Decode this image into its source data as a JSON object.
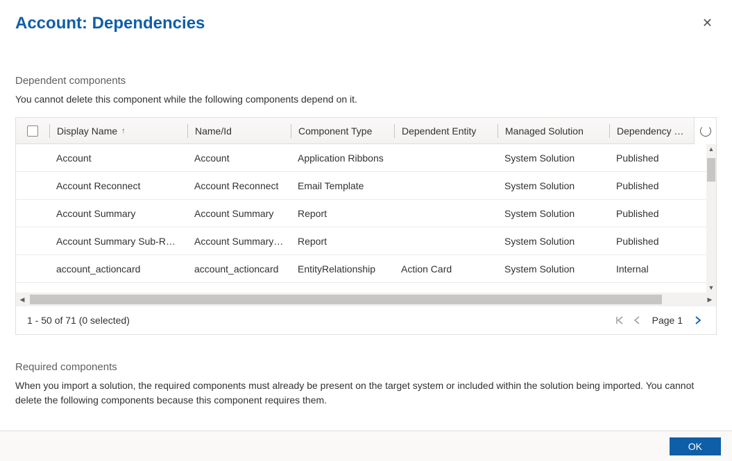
{
  "dialog": {
    "title": "Account: Dependencies",
    "close_label": "✕",
    "ok_label": "OK"
  },
  "dependent": {
    "section_title": "Dependent components",
    "description": "You cannot delete this component while the following components depend on it.",
    "columns": {
      "display": "Display Name",
      "name": "Name/Id",
      "type": "Component Type",
      "entity": "Dependent Entity",
      "managed": "Managed Solution",
      "dep": "Dependency …"
    },
    "sort_indicator": "↑",
    "rows": [
      {
        "display": "Account",
        "name": "Account",
        "type": "Application Ribbons",
        "entity": "",
        "managed": "System Solution",
        "dep": "Published"
      },
      {
        "display": "Account Reconnect",
        "name": "Account Reconnect",
        "type": "Email Template",
        "entity": "",
        "managed": "System Solution",
        "dep": "Published"
      },
      {
        "display": "Account Summary",
        "name": "Account Summary",
        "type": "Report",
        "entity": "",
        "managed": "System Solution",
        "dep": "Published"
      },
      {
        "display": "Account Summary Sub-Report",
        "name": "Account Summary S…",
        "type": "Report",
        "entity": "",
        "managed": "System Solution",
        "dep": "Published"
      },
      {
        "display": "account_actioncard",
        "name": "account_actioncard",
        "type": "EntityRelationship",
        "entity": "Action Card",
        "managed": "System Solution",
        "dep": "Internal"
      }
    ],
    "footer_status": "1 - 50 of 71 (0 selected)",
    "page_label": "Page 1"
  },
  "required": {
    "section_title": "Required components",
    "description": "When you import a solution, the required components must already be present on the target system or included within the solution being imported. You cannot delete the following components because this component requires them."
  }
}
